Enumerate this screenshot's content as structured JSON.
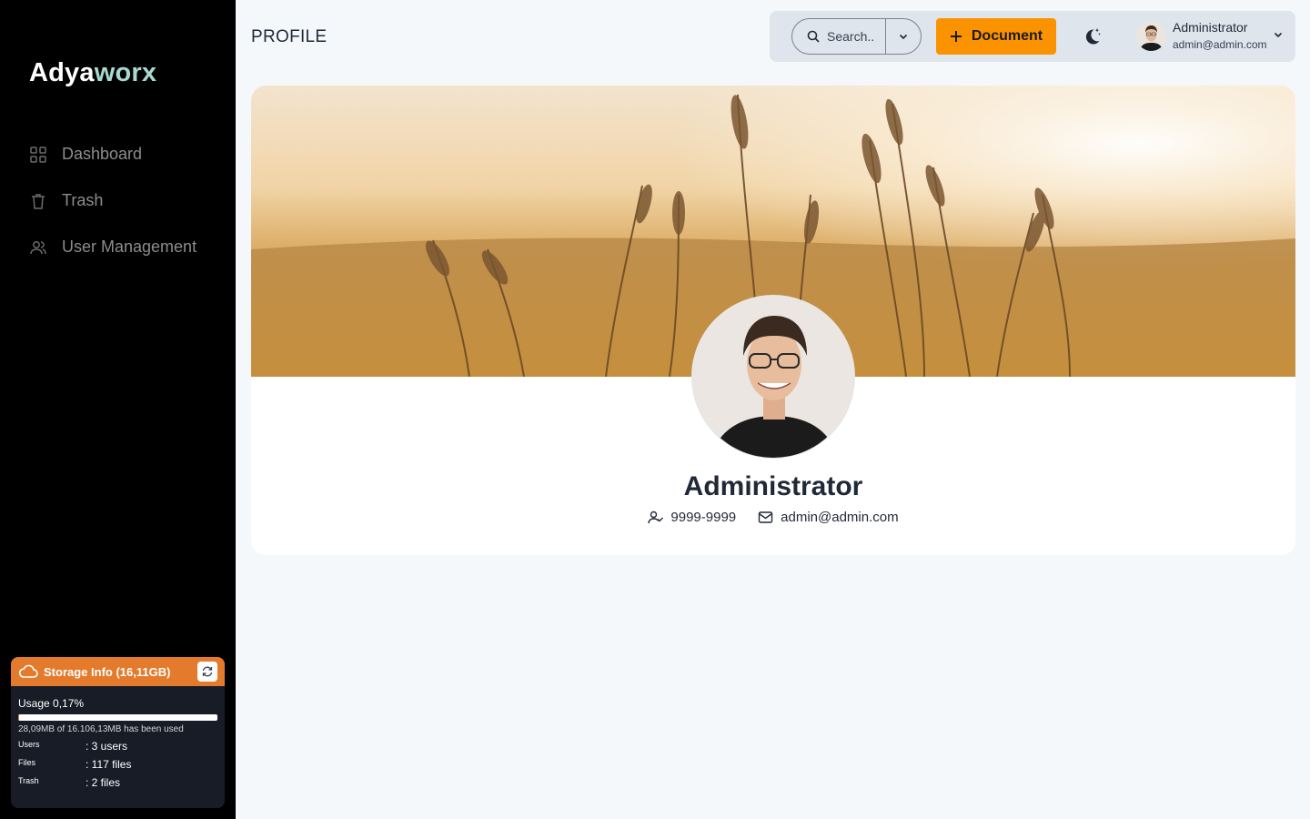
{
  "brand": {
    "part1": "Adya",
    "part2": "worx"
  },
  "sidebar": {
    "items": [
      {
        "label": "Dashboard",
        "icon": "grid-icon"
      },
      {
        "label": "Trash",
        "icon": "trash-icon"
      },
      {
        "label": "User Management",
        "icon": "users-icon"
      }
    ]
  },
  "storage": {
    "title": "Storage Info (16,11GB)",
    "usage_label": "Usage 0,17%",
    "usage_fraction": 0.0017,
    "used_text": "28,09MB of 16.106,13MB has been used",
    "stats": [
      {
        "key": "Users",
        "value": ": 3 users"
      },
      {
        "key": "Files",
        "value": ": 117 files"
      },
      {
        "key": "Trash",
        "value": ": 2 files"
      }
    ]
  },
  "header": {
    "page_title": "PROFILE",
    "search_placeholder": "Search..",
    "document_button": "Document",
    "user_name": "Administrator",
    "user_email": "admin@admin.com"
  },
  "profile": {
    "name": "Administrator",
    "phone": "9999-9999",
    "email": "admin@admin.com"
  },
  "colors": {
    "sidebar_bg": "#000000",
    "accent_orange": "#fb9300",
    "storage_header": "#e47a2c",
    "brand_accent": "#a8d8d0"
  }
}
